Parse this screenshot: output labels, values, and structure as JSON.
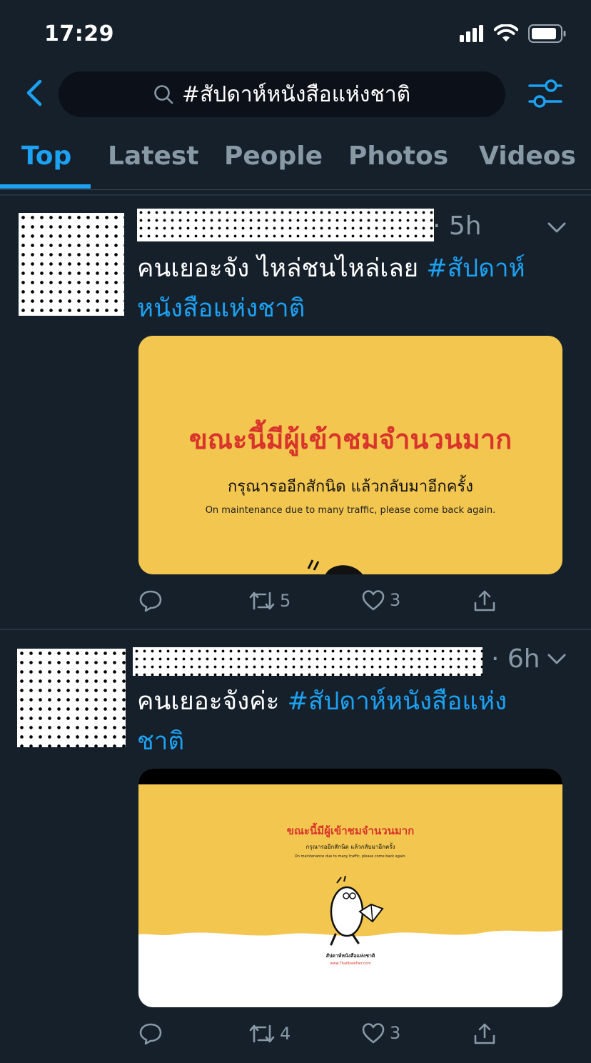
{
  "status_bar": {
    "time": "17:29"
  },
  "search": {
    "query": "#สัปดาห์หนังสือแห่งชาติ"
  },
  "tabs": [
    {
      "label": "Top",
      "active": true
    },
    {
      "label": "Latest",
      "active": false
    },
    {
      "label": "People",
      "active": false
    },
    {
      "label": "Photos",
      "active": false
    },
    {
      "label": "Videos",
      "active": false
    }
  ],
  "tweets": [
    {
      "time": "· 5h",
      "text": "คนเยอะจัง ไหล่ชนไหล่เลย ",
      "hashtag": "#สัปดาห์หนังสือแห่งชาติ",
      "media": {
        "heading": "ขณะนี้มีผู้เข้าชมจำนวนมาก",
        "subheading": "กรุณารออีกสักนิด แล้วกลับมาอีกครั้ง",
        "english": "On maintenance due to many traffic, please come back again."
      },
      "actions": {
        "reply": "",
        "retweet": "5",
        "like": "3"
      }
    },
    {
      "time": "· 6h",
      "text": "คนเยอะจังค่ะ ",
      "hashtag": "#สัปดาห์หนังสือแห่งชาติ",
      "media": {
        "heading": "ขณะนี้มีผู้เข้าชมจำนวนมาก",
        "subheading": "กรุณารออีกสักนิด แล้วกลับมาอีกครั้ง",
        "english": "On maintenance due to many traffic, please come back again.",
        "footer_logo": "สัปดาห์หนังสือแห่งชาติ",
        "footer_url": "www.ThaiBookFair.com"
      },
      "actions": {
        "reply": "",
        "retweet": "4",
        "like": "3"
      }
    }
  ],
  "colors": {
    "background": "#15202b",
    "accent": "#1da1f2",
    "muted": "#8899a6",
    "media_yellow": "#f2c64f",
    "media_red": "#d9342b"
  }
}
